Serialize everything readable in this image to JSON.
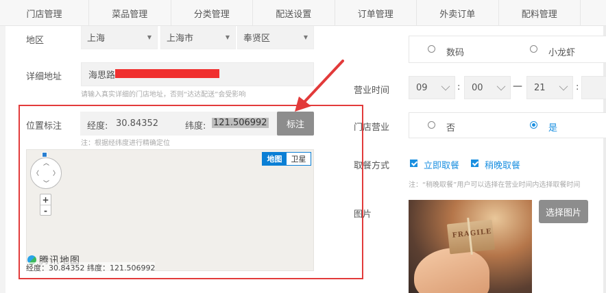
{
  "nav": {
    "tabs": [
      "门店管理",
      "菜品管理",
      "分类管理",
      "配送设置",
      "订单管理",
      "外卖订单",
      "配料管理"
    ]
  },
  "region": {
    "label": "地区",
    "province": "上海",
    "city": "上海市",
    "district": "奉贤区"
  },
  "address": {
    "label": "详细地址",
    "value": "海思路",
    "hint": "请输入真实详细的门店地址，否则“达达配送”会受影响"
  },
  "location": {
    "label": "位置标注",
    "lng_label": "经度:",
    "lng_value": "30.84352",
    "lat_label": "纬度:",
    "lat_value": "121.506992",
    "mark_button": "标注",
    "hint": "注：根据经纬度进行精确定位"
  },
  "map": {
    "type_map": "地图",
    "type_satellite": "卫星",
    "zoom_in": "+",
    "zoom_out": "-",
    "logo_text": "腾讯地图",
    "coords_text": "经度：30.84352 纬度：121.506992"
  },
  "category_options": {
    "option1": "数码",
    "option2": "小龙虾"
  },
  "hours": {
    "label": "营业时间",
    "start_hour": "09",
    "start_minute": "00",
    "separator": "—",
    "end_hour": "21",
    "colon": ":"
  },
  "open": {
    "label": "门店营业",
    "no": "否",
    "yes": "是"
  },
  "pickup": {
    "label": "取餐方式",
    "option_now": "立即取餐",
    "option_later": "稍晚取餐",
    "hint": "注：“稍晚取餐”用户可以选择在营业时间内选择取餐时间"
  },
  "image": {
    "label": "图片",
    "button": "选择图片",
    "box_text": "FRAGILE"
  },
  "colors": {
    "accent": "#1a8fe0",
    "highlight_border": "#e23a3a",
    "button_gray": "#8d8d8d"
  }
}
